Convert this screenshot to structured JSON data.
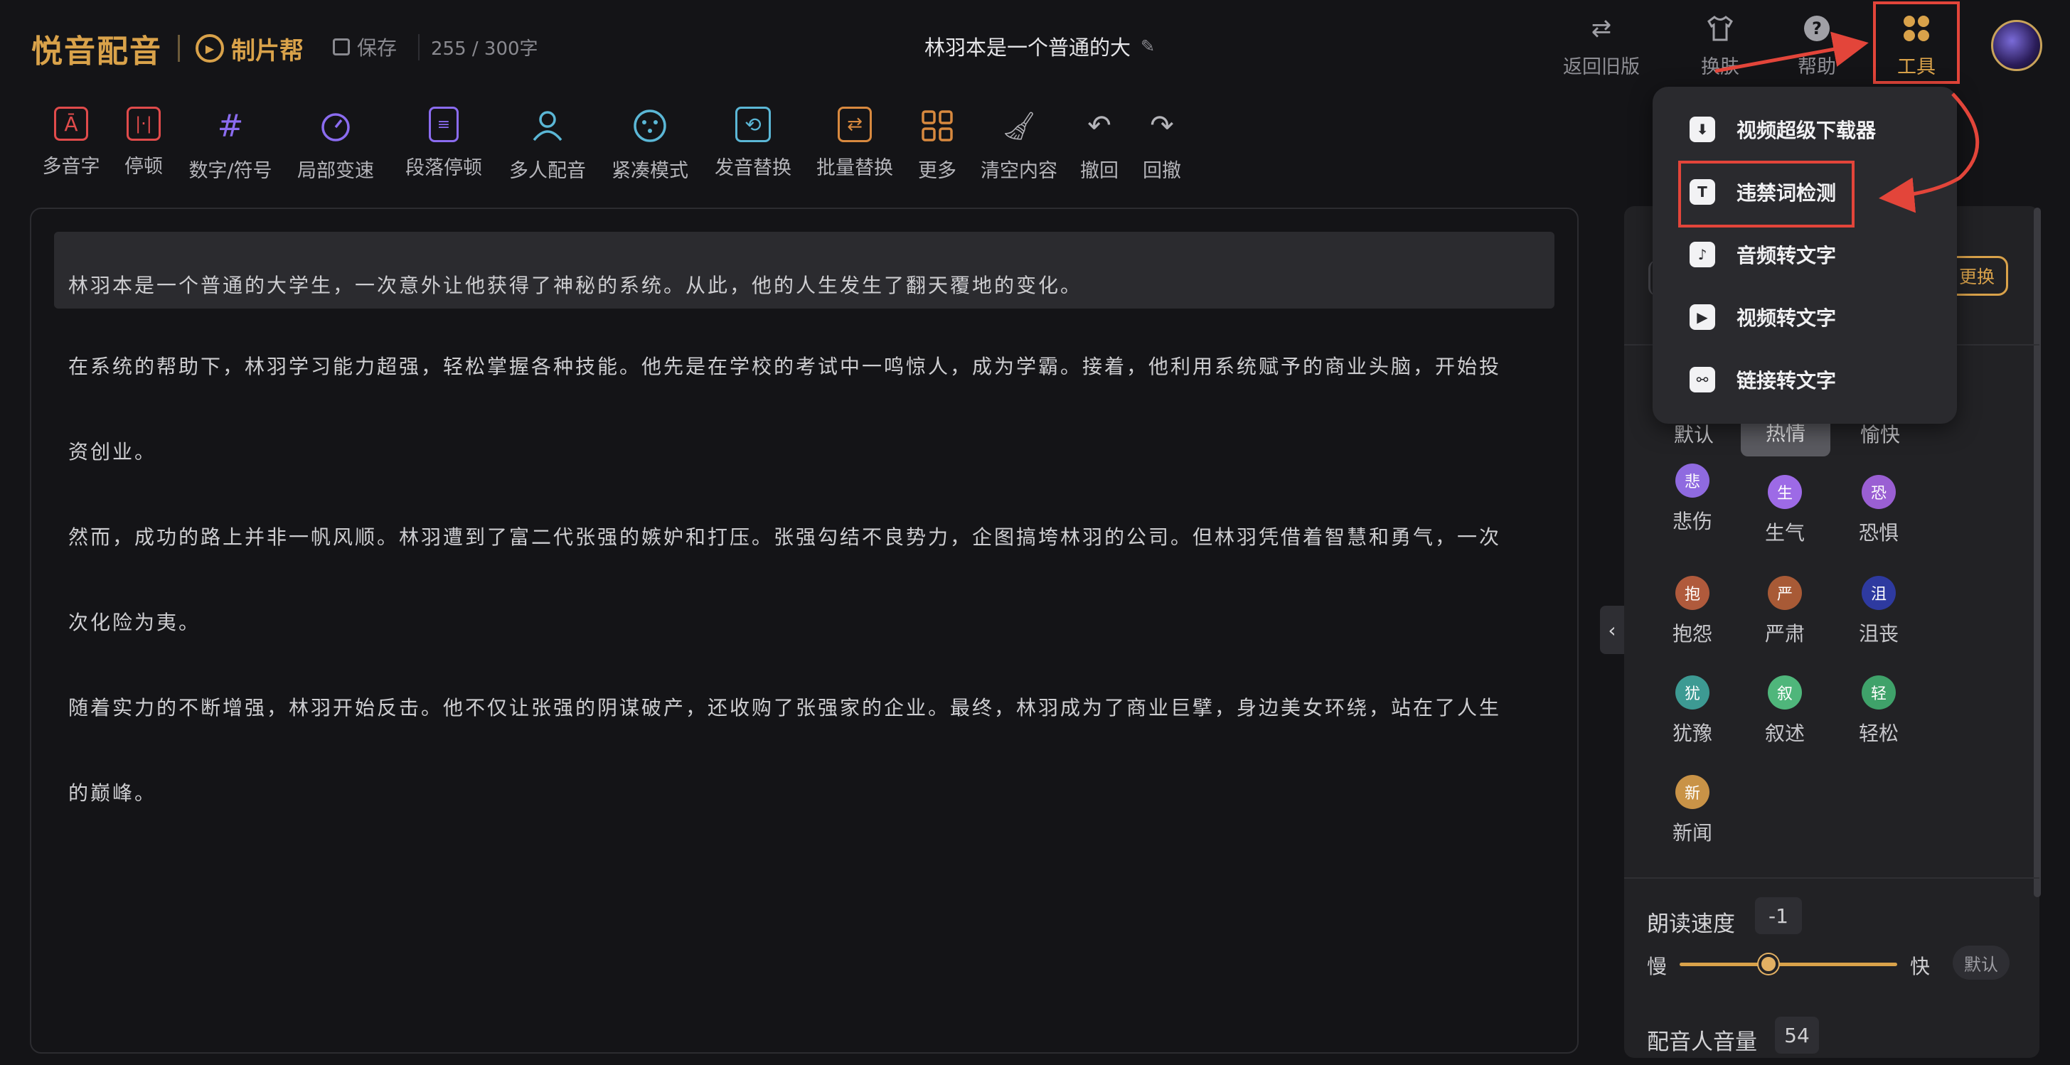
{
  "brand": {
    "main": "悦音配音",
    "sub": "制片帮",
    "play_icon": "play-circle-icon"
  },
  "header": {
    "save_label": "保存",
    "word_count": "255 / 300字",
    "doc_title": "林羽本是一个普通的大",
    "actions": [
      {
        "label": "返回旧版",
        "icon": "swap-arrows-icon"
      },
      {
        "label": "换肤",
        "icon": "shirt-icon"
      },
      {
        "label": "帮助",
        "icon": "question-icon"
      },
      {
        "label": "工具",
        "icon": "tools-grid-icon",
        "active": true
      }
    ]
  },
  "toolbar": [
    {
      "label": "多音字",
      "icon": "polyphone-icon",
      "color": "#e04b4b"
    },
    {
      "label": "停顿",
      "icon": "pause-icon",
      "color": "#e04b4b"
    },
    {
      "label": "数字/符号",
      "icon": "hash-icon",
      "color": "#8b6cf0"
    },
    {
      "label": "局部变速",
      "icon": "speed-icon",
      "color": "#8b6cf0"
    },
    {
      "label": "段落停顿",
      "icon": "paragraph-pause-icon",
      "color": "#8b6cf0"
    },
    {
      "label": "多人配音",
      "icon": "multi-user-icon",
      "color": "#5bb7d6"
    },
    {
      "label": "紧凑模式",
      "icon": "compact-icon",
      "color": "#5bb7d6"
    },
    {
      "label": "发音替换",
      "icon": "replace-icon",
      "color": "#5bb7d6"
    },
    {
      "label": "批量替换",
      "icon": "batch-replace-icon",
      "color": "#d8893f"
    },
    {
      "label": "更多",
      "icon": "more-grid-icon",
      "color": "#d8893f"
    },
    {
      "label": "清空内容",
      "icon": "broom-icon",
      "color": "#b4b4b9"
    },
    {
      "label": "撤回",
      "icon": "undo-icon",
      "color": "#b4b4b9"
    },
    {
      "label": "回撤",
      "icon": "redo-icon",
      "color": "#b4b4b9"
    }
  ],
  "editor": {
    "lines": [
      "林羽本是一个普通的大学生，一次意外让他获得了神秘的系统。从此，他的人生发生了翻天覆地的变化。",
      "在系统的帮助下，林羽学习能力超强，轻松掌握各种技能。他先是在学校的考试中一鸣惊人，成为学霸。接着，他利用系统赋予的商业头脑，开始投",
      "资创业。",
      "然而，成功的路上并非一帆风顺。林羽遭到了富二代张强的嫉妒和打压。张强勾结不良势力，企图搞垮林羽的公司。但林羽凭借着智慧和勇气，一次",
      "次化险为夷。",
      "随着实力的不断增强，林羽开始反击。他不仅让张强的阴谋破产，还收购了张强家的企业。最终，林羽成为了商业巨擘，身边美女环绕，站在了人生",
      "的巅峰。"
    ]
  },
  "dropdown": {
    "items": [
      {
        "label": "视频超级下载器",
        "icon": "download-icon"
      },
      {
        "label": "违禁词检测",
        "icon": "text-check-icon",
        "highlighted": true
      },
      {
        "label": "音频转文字",
        "icon": "audio-file-icon"
      },
      {
        "label": "视频转文字",
        "icon": "video-file-icon"
      },
      {
        "label": "链接转文字",
        "icon": "link-icon"
      }
    ]
  },
  "panel": {
    "swap_label": "更换",
    "emotions_top": {
      "default": "默认",
      "selected": "热情",
      "happy": "愉快"
    },
    "emotions": [
      {
        "badge": "悲",
        "label": "悲伤",
        "color": "#8f6ae0"
      },
      {
        "badge": "生",
        "label": "生气",
        "color": "#9d6ae6"
      },
      {
        "badge": "恐",
        "label": "恐惧",
        "color": "#9a5fd3"
      },
      {
        "badge": "抱",
        "label": "抱怨",
        "color": "#b05a3c"
      },
      {
        "badge": "严",
        "label": "严肃",
        "color": "#a85a36"
      },
      {
        "badge": "沮",
        "label": "沮丧",
        "color": "#2e3aa0"
      },
      {
        "badge": "犹",
        "label": "犹豫",
        "color": "#3d9a93"
      },
      {
        "badge": "叙",
        "label": "叙述",
        "color": "#4fb67b"
      },
      {
        "badge": "轻",
        "label": "轻松",
        "color": "#3fa26a"
      },
      {
        "badge": "新",
        "label": "新闻",
        "color": "#c99347"
      }
    ],
    "speed": {
      "label": "朗读速度",
      "value": "-1",
      "slow": "慢",
      "fast": "快",
      "default": "默认",
      "level": 0.41
    },
    "volume": {
      "label": "配音人音量",
      "value": "54"
    }
  },
  "colors": {
    "accent": "#d9a24a",
    "annotation": "#e3453a"
  }
}
